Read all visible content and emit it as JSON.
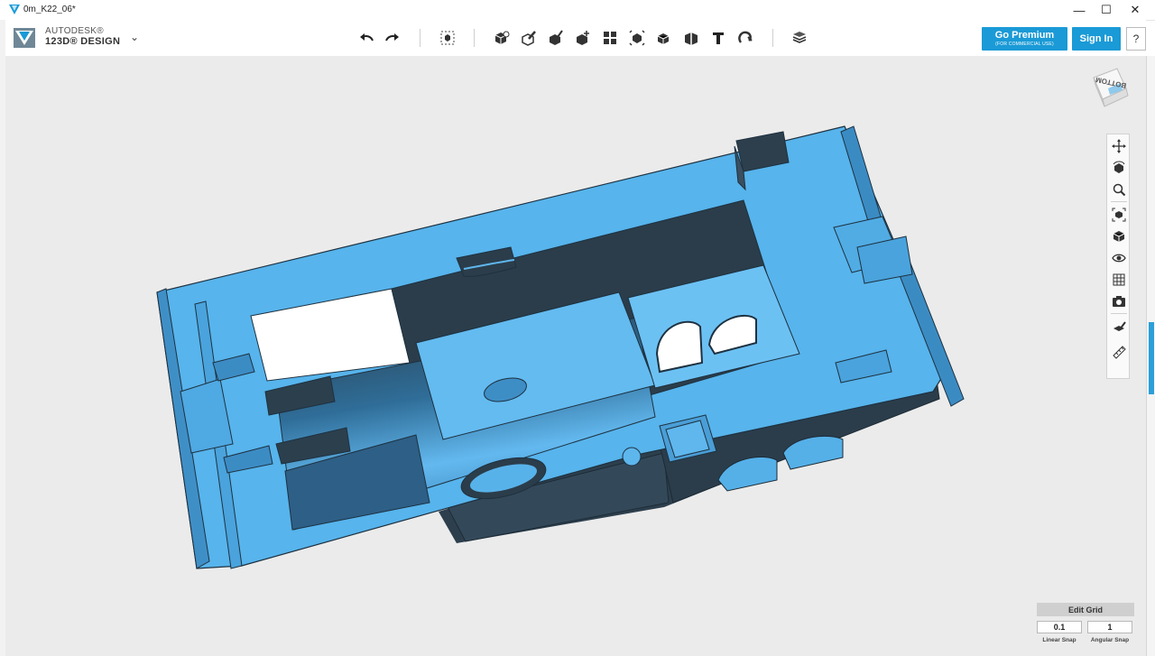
{
  "window": {
    "title": "0m_K22_06*",
    "minimize_glyph": "—",
    "maximize_glyph": "☐",
    "close_glyph": "✕"
  },
  "brand": {
    "line1": "AUTODESK®",
    "line2": "123D® DESIGN",
    "menu_glyph": "⌄"
  },
  "toolbar": {
    "icons": [
      "undo-icon",
      "redo-icon",
      "transform-icon",
      "primitives-icon",
      "sketch-icon",
      "construct-icon",
      "modify-icon",
      "pattern-icon",
      "group-icon",
      "combine-icon",
      "measure-icon",
      "text-icon",
      "snap-icon",
      "material-icon"
    ]
  },
  "account": {
    "premium_label": "Go Premium",
    "premium_sublabel": "(FOR COMMERCIAL USE)",
    "signin_label": "Sign In",
    "help_label": "?"
  },
  "viewcube": {
    "face_label": "BOTTOM"
  },
  "navbar": {
    "icons": [
      "pan-icon",
      "orbit-icon",
      "zoom-icon",
      "fit-icon",
      "view-icon",
      "visibility-icon",
      "materials-icon",
      "camera-icon",
      "snap-tool-icon",
      "ruler-tool-icon"
    ]
  },
  "grid": {
    "edit_label": "Edit Grid",
    "linear_value": "0.1",
    "angular_value": "1",
    "linear_label": "Linear Snap",
    "angular_label": "Angular Snap"
  },
  "colors": {
    "accent": "#1a9ad6",
    "model_light": "#56b3ea",
    "model_dark": "#2a3c4a",
    "viewport_bg": "#ebebeb"
  }
}
